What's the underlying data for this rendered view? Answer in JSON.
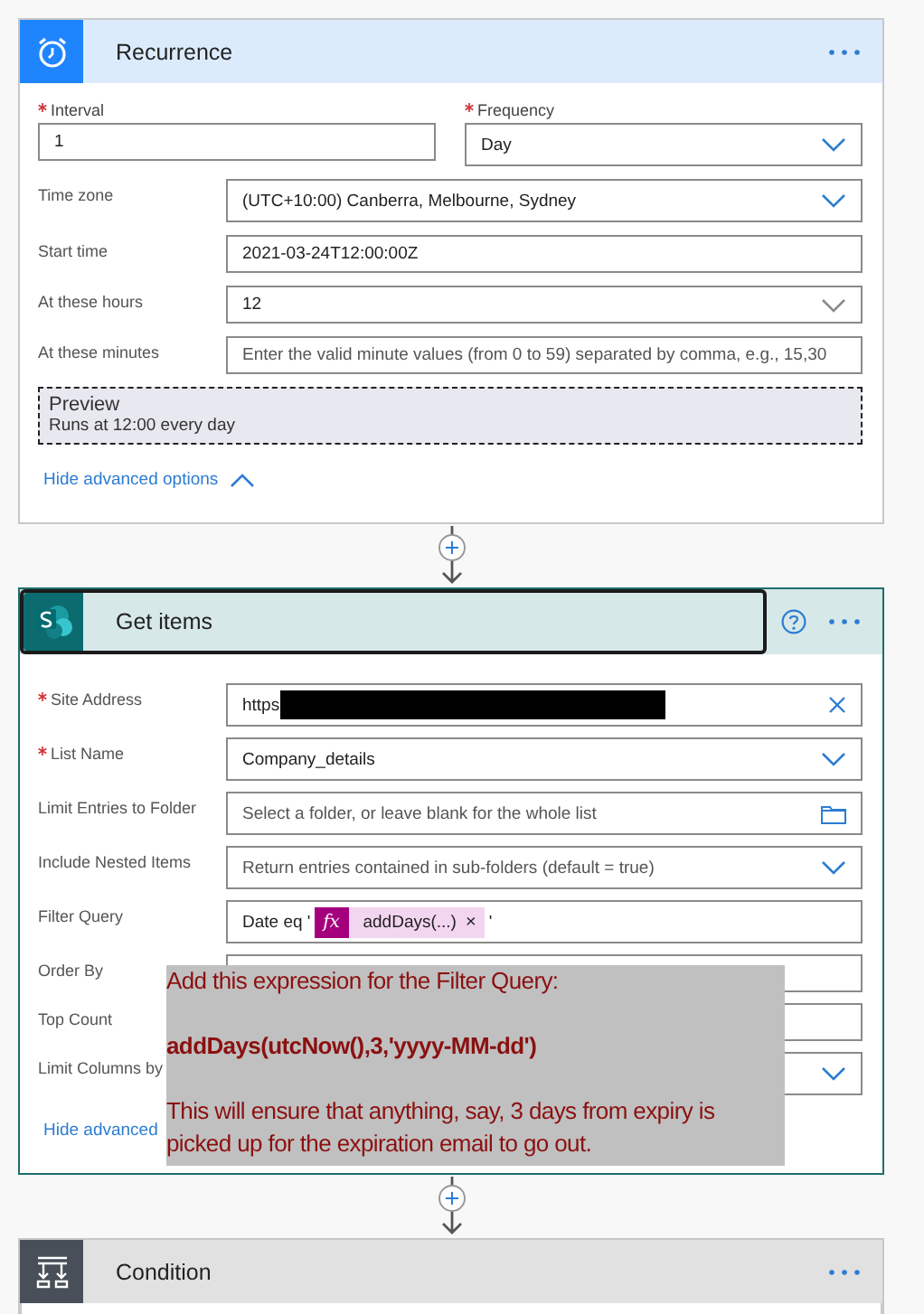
{
  "recurrence": {
    "title": "Recurrence",
    "pair": [
      {
        "label": "Interval",
        "required": true,
        "kind": "text",
        "value": "1"
      },
      {
        "label": "Frequency",
        "required": true,
        "kind": "dropdown",
        "value": "Day"
      }
    ],
    "rows": [
      {
        "label": "Time zone",
        "kind": "dropdown",
        "value": "(UTC+10:00) Canberra, Melbourne, Sydney"
      },
      {
        "label": "Start time",
        "kind": "text",
        "value": "2021-03-24T12:00:00Z"
      },
      {
        "label": "At these hours",
        "kind": "select",
        "value": "12"
      },
      {
        "label": "At these minutes",
        "kind": "text",
        "placeholder": "Enter the valid minute values (from 0 to 59) separated by comma, e.g., 15,30"
      }
    ],
    "preview": {
      "title": "Preview",
      "text": "Runs at 12:00 every day"
    },
    "toggle": "Hide advanced options"
  },
  "get_items": {
    "title": "Get items",
    "selected": true,
    "rows": [
      {
        "label": "Site Address",
        "required": true,
        "kind": "clear",
        "value": "https"
      },
      {
        "label": "List Name",
        "required": true,
        "kind": "dropdown",
        "value": "Company_details"
      },
      {
        "label": "Limit Entries to Folder",
        "required": false,
        "kind": "folder",
        "placeholder": "Select a folder, or leave blank for the whole list"
      },
      {
        "label": "Include Nested Items",
        "required": false,
        "kind": "dropdown",
        "placeholder": "Return entries contained in sub-folders (default = true)"
      },
      {
        "label": "Filter Query",
        "required": false,
        "kind": "expression",
        "value": "Date eq '",
        "token_icon": "fx",
        "token": "addDays(...)",
        "token_close": "×",
        "suffix": "'"
      },
      {
        "label": "Order By",
        "required": false,
        "kind": "text"
      },
      {
        "label": "Top Count",
        "required": false,
        "kind": "text"
      },
      {
        "label": "Limit Columns by",
        "required": false,
        "kind": "dropdown"
      }
    ],
    "toggle": "Hide advanced"
  },
  "note": {
    "lines": [
      "Add this expression for the Filter Query:",
      "**addDays(utcNow(),3,'yyyy-MM-dd')**",
      "This will ensure that anything, say, 3 days from expiry is picked up for the expiration email to go out."
    ]
  },
  "condition": {
    "title": "Condition"
  }
}
